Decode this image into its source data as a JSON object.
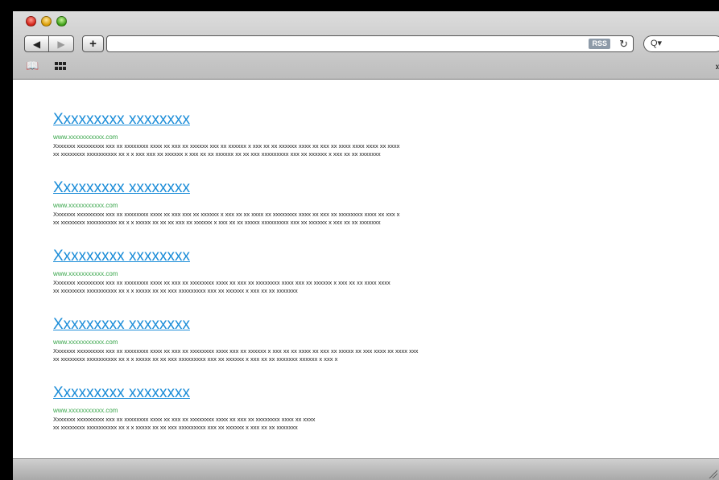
{
  "toolbar": {
    "back_glyph": "◀",
    "forward_glyph": "▶",
    "add_glyph": "+",
    "rss_label": "RSS",
    "reload_glyph": "↻",
    "search_glyph": "Q▾"
  },
  "bookmarks": {
    "book_glyph": "📖",
    "more_glyph": "»"
  },
  "results": [
    {
      "title": "Xxxxxxxxx xxxxxxxx",
      "url": "www.xxxxxxxxxxx.com",
      "desc": "Xxxxxxx xxxxxxxxx xxx xx xxxxxxxx xxxx xx xxx xx xxxxxx xxx xx xxxxxx x xxx xx xx xxxxxx xxxx xx xxx xx xxxx xxxx xxxx xx xxxx\nxx xxxxxxxx xxxxxxxxxx xx x x xxx xxx xx xxxxxx x xxx xx xx xxxxxx xx xx xxx xxxxxxxxx xxx xx xxxxxx x xxx xx xx xxxxxxx"
    },
    {
      "title": "Xxxxxxxxx xxxxxxxx",
      "url": "www.xxxxxxxxxxx.com",
      "desc": "Xxxxxxx xxxxxxxxx xxx xx xxxxxxxx xxxx xx xxx xxx xx xxxxxx x xxx xx xx xxxx xx xxxxxxxx xxxx xx xxx xx xxxxxxxx xxxx xx xxx x\nxx xxxxxxxx xxxxxxxxxx xx x x xxxxx xx xx xx xxx xx xxxxxx x xxx xx xx xxxxx xxxxxxxxx xxx xx xxxxxx x xxx xx xx xxxxxxx"
    },
    {
      "title": "Xxxxxxxxx xxxxxxxx",
      "url": "www.xxxxxxxxxxx.com",
      "desc": "Xxxxxxx xxxxxxxxx xxx xx xxxxxxxx xxxx xx xxx xx xxxxxxxx xxxx xx xxx xx xxxxxxxx xxxx xxx xx xxxxxx x xxx xx xx xxxx xxxx\nxx xxxxxxxx xxxxxxxxxx xx x x xxxxx xx xx xxx xxxxxxxxx xxx xx xxxxxx x xxx xx xx xxxxxxx"
    },
    {
      "title": "Xxxxxxxxx xxxxxxxx",
      "url": "www.xxxxxxxxxxx.com",
      "desc": "Xxxxxxx xxxxxxxxx xxx xx xxxxxxxx xxxx xx xxx xx xxxxxxxx xxxx xxx xx xxxxxx x xxx xx xx xxxx xx xxx xx xxxxx xx xxx xxxx xx xxxx xxx\nxx xxxxxxxx xxxxxxxxxx xx x x xxxxx xx xx xxx xxxxxxxxx xxx xx xxxxxx x xxx xx xx xxxxxxx xxxxxx x xxx x"
    },
    {
      "title": "Xxxxxxxxx xxxxxxxx",
      "url": "www.xxxxxxxxxxx.com",
      "desc": "Xxxxxxx xxxxxxxxx xxx xx xxxxxxxx xxxx xx xxx xx xxxxxxxx xxxx xx xxx xx xxxxxxxx xxxx xx xxxx\nxx xxxxxxxx xxxxxxxxxx xx x x xxxxx xx xx xxx xxxxxxxxx xxx xx xxxxxx x xxx xx xx xxxxxxx"
    }
  ]
}
